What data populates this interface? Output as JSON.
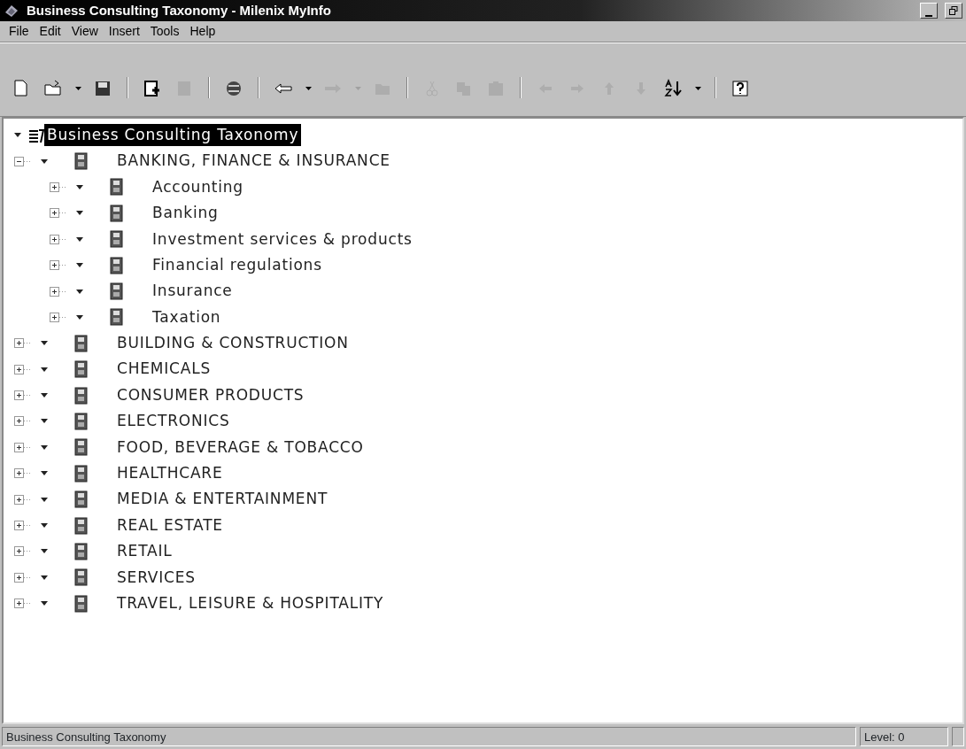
{
  "window": {
    "title": "Business Consulting Taxonomy - Milenix MyInfo"
  },
  "menu": [
    "File",
    "Edit",
    "View",
    "Insert",
    "Tools",
    "Help"
  ],
  "toolbar": [
    {
      "kind": "new",
      "disabled": false
    },
    {
      "kind": "open",
      "disabled": false
    },
    {
      "kind": "dropdown",
      "disabled": false
    },
    {
      "kind": "save",
      "disabled": false
    },
    {
      "kind": "separator"
    },
    {
      "kind": "add-doc",
      "disabled": false
    },
    {
      "kind": "doc",
      "disabled": true
    },
    {
      "kind": "separator"
    },
    {
      "kind": "globe",
      "disabled": false
    },
    {
      "kind": "separator"
    },
    {
      "kind": "back",
      "disabled": false
    },
    {
      "kind": "dropdown",
      "disabled": false
    },
    {
      "kind": "forward",
      "disabled": true
    },
    {
      "kind": "dropdown",
      "disabled": true
    },
    {
      "kind": "folder",
      "disabled": true
    },
    {
      "kind": "separator"
    },
    {
      "kind": "cut",
      "disabled": true
    },
    {
      "kind": "copy",
      "disabled": true
    },
    {
      "kind": "paste",
      "disabled": true
    },
    {
      "kind": "separator"
    },
    {
      "kind": "left",
      "disabled": true
    },
    {
      "kind": "right",
      "disabled": true
    },
    {
      "kind": "up",
      "disabled": true
    },
    {
      "kind": "down",
      "disabled": true
    },
    {
      "kind": "sort",
      "disabled": false
    },
    {
      "kind": "dropdown",
      "disabled": false
    },
    {
      "kind": "separator"
    },
    {
      "kind": "help",
      "disabled": false
    }
  ],
  "tree": {
    "label": "Business Consulting Taxonomy",
    "selected": true,
    "expanded": true,
    "children": [
      {
        "label": "BANKING, FINANCE & INSURANCE",
        "selected": false,
        "expanded": true,
        "children": [
          {
            "label": "Accounting",
            "selected": false,
            "expanded": false
          },
          {
            "label": "Banking",
            "selected": false,
            "expanded": false
          },
          {
            "label": "Investment services & products",
            "selected": false,
            "expanded": false
          },
          {
            "label": "Financial regulations",
            "selected": false,
            "expanded": false
          },
          {
            "label": "Insurance",
            "selected": false,
            "expanded": false
          },
          {
            "label": "Taxation",
            "selected": false,
            "expanded": false
          }
        ]
      },
      {
        "label": "BUILDING & CONSTRUCTION",
        "selected": false,
        "expanded": false
      },
      {
        "label": "CHEMICALS",
        "selected": false,
        "expanded": false
      },
      {
        "label": "CONSUMER PRODUCTS",
        "selected": false,
        "expanded": false
      },
      {
        "label": "ELECTRONICS",
        "selected": false,
        "expanded": false
      },
      {
        "label": "FOOD, BEVERAGE & TOBACCO",
        "selected": false,
        "expanded": false
      },
      {
        "label": "HEALTHCARE",
        "selected": false,
        "expanded": false
      },
      {
        "label": "MEDIA & ENTERTAINMENT",
        "selected": false,
        "expanded": false
      },
      {
        "label": "REAL ESTATE",
        "selected": false,
        "expanded": false
      },
      {
        "label": "RETAIL",
        "selected": false,
        "expanded": false
      },
      {
        "label": "SERVICES",
        "selected": false,
        "expanded": false
      },
      {
        "label": "TRAVEL, LEISURE & HOSPITALITY",
        "selected": false,
        "expanded": false
      }
    ]
  },
  "status_bar": {
    "message": "Business Consulting Taxonomy",
    "level": "Level: 0"
  }
}
